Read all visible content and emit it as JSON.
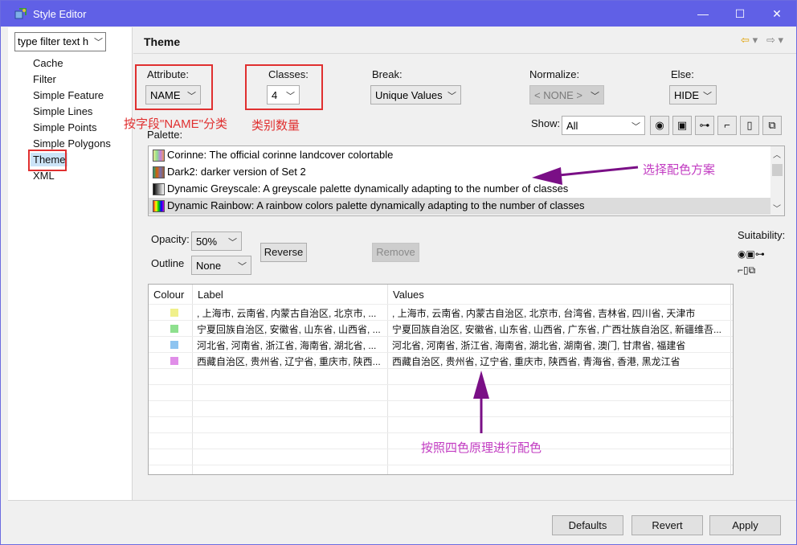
{
  "window": {
    "title": "Style Editor",
    "minimize": "—",
    "maximize": "☐",
    "close": "✕"
  },
  "sidebar": {
    "filter_text": "type filter text h",
    "items": [
      "Cache",
      "Filter",
      "Simple Feature",
      "Simple Lines",
      "Simple Points",
      "Simple Polygons",
      "Theme",
      "XML"
    ],
    "selected": "Theme"
  },
  "main": {
    "title": "Theme",
    "nav": {
      "back": "⇦",
      "back_menu": "▾",
      "forward": "⇨",
      "forward_menu": "▾"
    }
  },
  "controls": {
    "attribute_label": "Attribute:",
    "attribute_value": "NAME",
    "classes_label": "Classes:",
    "classes_value": "4",
    "break_label": "Break:",
    "break_value": "Unique Values",
    "normalize_label": "Normalize:",
    "normalize_value": "< NONE >",
    "else_label": "Else:",
    "else_value": "HIDE",
    "show_label": "Show:",
    "show_value": "All",
    "palette_label": "Palette:",
    "opacity_label": "Opacity:",
    "opacity_value": "50%",
    "outline_label": "Outline",
    "outline_value": "None",
    "reverse_label": "Reverse",
    "remove_label": "Remove",
    "suitability_label": "Suitability:"
  },
  "show_icons": [
    "eye-icon",
    "monitor-icon",
    "projector-icon",
    "laptop-icon",
    "book-icon",
    "copy-icon"
  ],
  "palettes": [
    {
      "name": "Corinne: The official corinne landcover colortable"
    },
    {
      "name": "Dark2: darker version of Set 2"
    },
    {
      "name": "Dynamic Greyscale: A greyscale palette dynamically adapting to the number of classes"
    },
    {
      "name": "Dynamic Rainbow: A rainbow colors palette dynamically adapting to the number of classes",
      "selected": true
    }
  ],
  "table": {
    "headers": [
      "Colour",
      "Label",
      "Values"
    ],
    "rows": [
      {
        "colour": "#f0f08a",
        "label": ", 上海市, 云南省, 内蒙古自治区, 北京市, ...",
        "values": ", 上海市, 云南省, 内蒙古自治区, 北京市, 台湾省, 吉林省, 四川省, 天津市"
      },
      {
        "colour": "#8ee08e",
        "label": "宁夏回族自治区, 安徽省, 山东省, 山西省, ...",
        "values": "宁夏回族自治区, 安徽省, 山东省, 山西省, 广东省, 广西壮族自治区, 新疆维吾..."
      },
      {
        "colour": "#8ec4f0",
        "label": "河北省, 河南省, 浙江省, 海南省, 湖北省, ...",
        "values": "河北省, 河南省, 浙江省, 海南省, 湖北省, 湖南省, 澳门, 甘肃省, 福建省"
      },
      {
        "colour": "#e08ee8",
        "label": "西藏自治区, 贵州省, 辽宁省, 重庆市, 陕西...",
        "values": "西藏自治区, 贵州省, 辽宁省, 重庆市, 陕西省, 青海省, 香港, 黑龙江省"
      }
    ]
  },
  "annotations": {
    "attribute_note": "按字段\"NAME\"分类",
    "classes_note": "类别数量",
    "palette_note": "选择配色方案",
    "values_note": "按照四色原理进行配色"
  },
  "footer": {
    "defaults": "Defaults",
    "revert": "Revert",
    "apply": "Apply"
  },
  "colors": {
    "titlebar": "#6060e6",
    "annotation_red": "#e03030",
    "annotation_purple": "#c23cc2",
    "arrow_purple": "#7a0f86"
  }
}
